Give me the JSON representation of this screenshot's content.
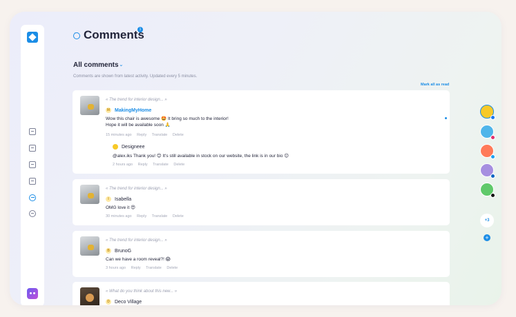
{
  "header": {
    "title": "Comments",
    "badge": "1"
  },
  "filter": {
    "label": "All comments"
  },
  "subtitle": "Comments are shown from latest activity. Updated every 5 minutes.",
  "mark_all": "Mark all as read",
  "actions": {
    "reply": "Reply",
    "translate": "Translate",
    "delete": "Delete"
  },
  "comments": [
    {
      "post": "« The trend for interior design... »",
      "user": "MakingMyHome",
      "initial": "M",
      "line1": "Wow this chair is awesome 🤩 It bring so much to the interior!",
      "line2": "Hope it will be available soon 🙏",
      "time": "15 minutes ago",
      "reply": {
        "user": "Designeee",
        "text": "@alex.iks Thank you! 😊 It's still available in stock on our website, the link is in our bio 😉",
        "time": "2 hours ago"
      }
    },
    {
      "post": "« The trend for interior design... »",
      "user": "Isabella",
      "initial": "I",
      "line1": "OMG love it 😍",
      "time": "30 minutes ago"
    },
    {
      "post": "« The trend for interior design... »",
      "user": "BrunoG",
      "initial": "B",
      "line1": "Can we have a room reveal?! 😱",
      "time": "3 hours ago"
    },
    {
      "post": "« What do you think about this new... »",
      "user": "Deco Village",
      "initial": "D"
    }
  ],
  "accounts": {
    "more": "+3",
    "add": "+",
    "colors": [
      "#f7c928",
      "#4fb5ea",
      "#ff7a59",
      "#a68fe0",
      "#5fc96a"
    ],
    "networks": [
      "facebook",
      "instagram",
      "twitter",
      "linkedin",
      "tiktok"
    ]
  }
}
